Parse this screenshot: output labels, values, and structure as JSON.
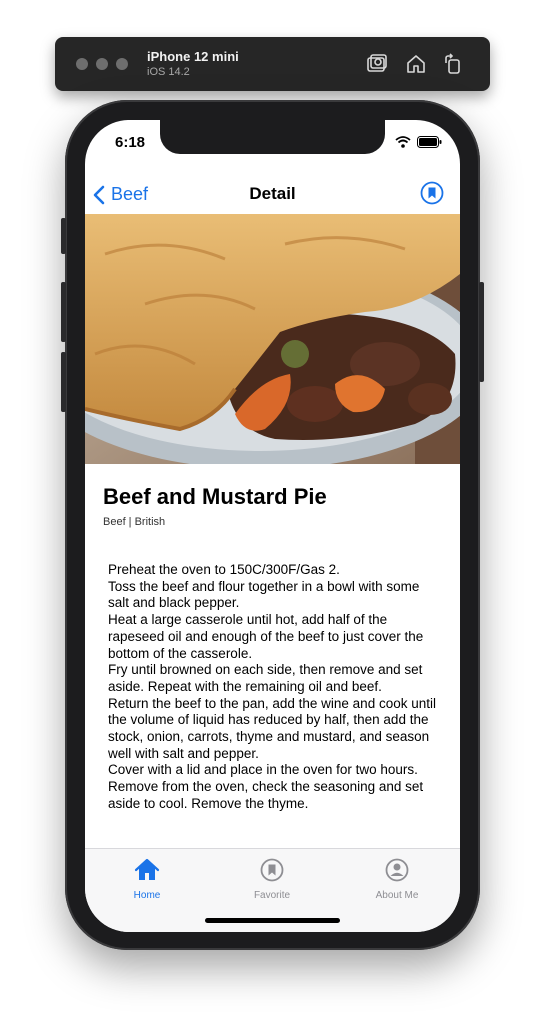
{
  "simulator": {
    "device_name": "iPhone 12 mini",
    "os_version": "iOS 14.2",
    "buttons": [
      "screenshot-icon",
      "home-icon",
      "rotate-icon"
    ]
  },
  "status_bar": {
    "time": "6:18",
    "icons": [
      "wifi-icon",
      "battery-icon"
    ]
  },
  "nav": {
    "back_label": "Beef",
    "title": "Detail",
    "accent": "#1a73e8"
  },
  "recipe": {
    "title": "Beef and Mustard Pie",
    "meta": "Beef | British",
    "instructions": "Preheat the oven to 150C/300F/Gas 2.\nToss the beef and flour together in a bowl with some salt and black pepper.\nHeat a large casserole until hot, add half of the rapeseed oil and enough of the beef to just cover the bottom of the casserole.\nFry until browned on each side, then remove and set aside. Repeat with the remaining oil and beef.\nReturn the beef to the pan, add the wine and cook until the volume of liquid has reduced by half, then add the stock, onion, carrots, thyme and mustard, and season well with salt and pepper.\nCover with a lid and place in the oven for two hours.\nRemove from the oven, check the seasoning and set aside to cool. Remove the thyme."
  },
  "tabs": [
    {
      "label": "Home",
      "icon": "house-icon",
      "active": true
    },
    {
      "label": "Favorite",
      "icon": "bookmark-icon",
      "active": false
    },
    {
      "label": "About Me",
      "icon": "person-icon",
      "active": false
    }
  ]
}
